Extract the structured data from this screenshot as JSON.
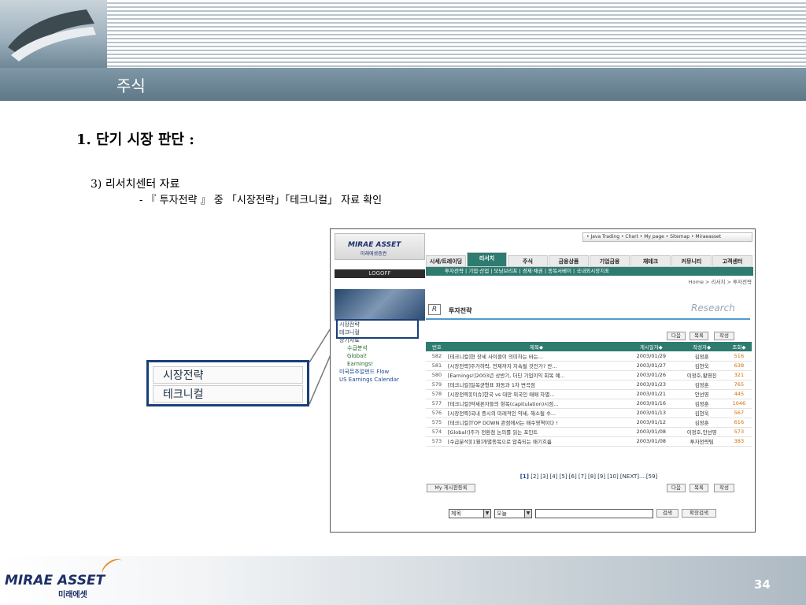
{
  "slide": {
    "title": "주식",
    "heading1": "1. 단기 시장 판단 :",
    "heading2": "3) 리서치센터 자료",
    "heading3": "- 『 투자전략 』 중 「시장전략」「테크니컬」 자료 확인",
    "page_number": "34",
    "footer_logo": "MIRAE ASSET",
    "footer_logo_sub": "미래에셋"
  },
  "callout": {
    "items": [
      "시장전략",
      "테크니컬"
    ]
  },
  "website": {
    "logo": "MIRAE ASSET",
    "logo_sub": "미래에셋증권",
    "logoff": "LOGOFF",
    "top_links": "• Java Trading  • Chart  • My page   • Sitemap  • Miraeasset",
    "tabs": [
      "시세/트레이딩",
      "리서치",
      "주식",
      "금융상품",
      "기업금융",
      "재테크",
      "커뮤니티",
      "고객센터"
    ],
    "active_tab": "리서치",
    "subnav": "투자전략  |  기업·산업  |  모닝브리프  |  경제·채권  |  종목서베이  |  국내외시장지표",
    "breadcrumb": "Home > 리서치 > 투자전략",
    "page_heading": "투자전략",
    "research_label": "Research",
    "side_menu": [
      {
        "label": "시장전략",
        "style": "normal"
      },
      {
        "label": "테크니컬",
        "style": "normal"
      },
      {
        "label": "장기자료",
        "style": "normal"
      },
      {
        "label": "수급분석",
        "style": "sub"
      },
      {
        "label": "Global!",
        "style": "sub"
      },
      {
        "label": "Earnings!",
        "style": "sub"
      },
      {
        "label": "미국뮤추얼펀드 Flow",
        "style": "blue"
      },
      {
        "label": "US Earnings Calendar",
        "style": "blue"
      }
    ],
    "buttons": {
      "next": "다음",
      "list": "목록",
      "write": "작성",
      "my_board": "My 게시판등록",
      "search": "검색",
      "ext_search": "확장검색"
    },
    "table": {
      "headers": [
        "번호",
        "제목◆",
        "게시일자◆",
        "작성자◆",
        "조회◆"
      ],
      "rows": [
        [
          "582",
          "[테크니컬]현 장세 사이클이 의미하는 바는...",
          "2003/01/29",
          "김정훈",
          "516"
        ],
        [
          "581",
          "[시장전략]주가하락, 언제까지 지속될 것인가? 반...",
          "2003/01/27",
          "김현욱",
          "638"
        ],
        [
          "580",
          "[Earnings!]2003년 상반기, 더딘 기업이익 회복 예...",
          "2003/01/26",
          "이정호,황영진",
          "321"
        ],
        [
          "579",
          "[테크니컬]일목균형표 파동과 1차 변곡점",
          "2003/01/23",
          "김정훈",
          "765"
        ],
        [
          "578",
          "[시장전략][이슈]한국 vs 대만 외국인 매매 차별...",
          "2003/01/21",
          "안선영",
          "445"
        ],
        [
          "577",
          "[테크니컬]약세론자들의 항복(capitulation)시점...",
          "2003/01/16",
          "김정훈",
          "1046"
        ],
        [
          "576",
          "[시장전략]국내 증시의 미래적인 약세, 해소될 수...",
          "2003/01/13",
          "김현욱",
          "567"
        ],
        [
          "575",
          "[테크니컬]TOP DOWN 관점에서는 매수영역이다 !",
          "2003/01/12",
          "김정훈",
          "616"
        ],
        [
          "574",
          "[Global!]주가 전환점 논의를 읽는 포인트",
          "2003/01/08",
          "이정호,안선영",
          "573"
        ],
        [
          "573",
          "[수급분석][1월]개별종목으로 압축되는 매기흐름",
          "2003/01/08",
          "투자전략팀",
          "383"
        ]
      ]
    },
    "pager_current": "[1]",
    "pager_rest": " [2] [3] [4] [5] [6] [7] [8] [9] [10] [NEXT]....[59]",
    "search_field": "제목",
    "search_period": "오늘"
  },
  "colors": {
    "header_bar": "#6d8797",
    "site_accent": "#2e7b6f",
    "callout_border": "#1a3f7a"
  }
}
